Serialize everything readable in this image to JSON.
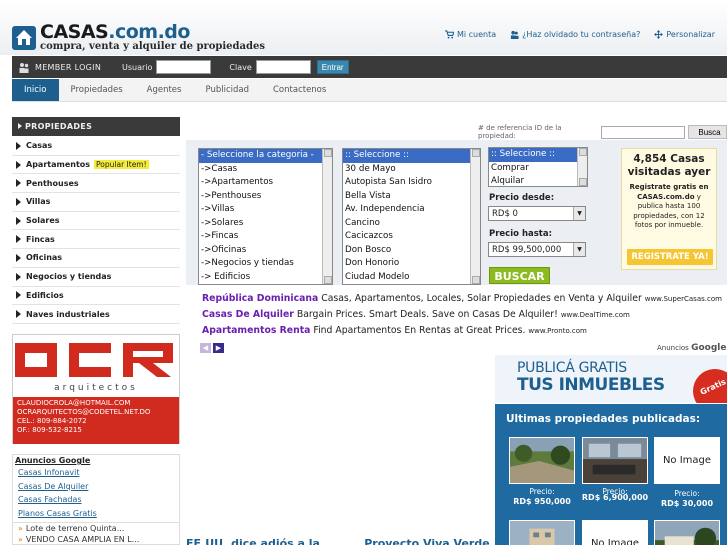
{
  "header": {
    "logo_text": "CASAS",
    "logo_domain": ".com.do",
    "tagline": "compra, venta y alquiler de propiedades",
    "links": [
      {
        "icon": "cart-icon",
        "label": "Mi cuenta"
      },
      {
        "icon": "users-icon",
        "label": "¿Haz olvidado tu contraseña?"
      },
      {
        "icon": "move-icon",
        "label": "Personalizar"
      }
    ]
  },
  "login": {
    "title": "MEMBER LOGIN",
    "user_label": "Usuario",
    "pass_label": "Clave",
    "button": "Entrar"
  },
  "nav": {
    "tabs": [
      "Inicio",
      "Propiedades",
      "Agentes",
      "Publicidad",
      "Contactenos"
    ],
    "active": "Inicio"
  },
  "sidebar": {
    "title": "PROPIEDADES",
    "items": [
      {
        "label": "Casas"
      },
      {
        "label": "Apartamentos",
        "badge": "Popular Item!"
      },
      {
        "label": "Penthouses"
      },
      {
        "label": "Villas"
      },
      {
        "label": "Solares"
      },
      {
        "label": "Fincas"
      },
      {
        "label": "Oficinas"
      },
      {
        "label": "Negocios y tiendas"
      },
      {
        "label": "Edificios"
      },
      {
        "label": "Naves industriales"
      }
    ]
  },
  "ocr_ad": {
    "logo": "OCR",
    "subtitle": "arquitectos",
    "lines": [
      "CLAUDIOCROLA@HOTMAIL.COM",
      "OCRARQUITECTOS@CODETEL.NET.DO",
      "CEL.: 809-884-2072",
      "OF.: 809-532-8215"
    ]
  },
  "google_box": {
    "title": "Anuncios Google",
    "links": [
      "Casas Infonavit",
      "Casas De Alquiler",
      "Casas Fachadas",
      "Planos Casas Gratis"
    ],
    "recent": [
      "Lote de terreno Quinta...",
      "VENDO CASA AMPLIA EN L..."
    ]
  },
  "search": {
    "ref_label": "# de referencia ID de la propiedad:",
    "ref_button": "Busca",
    "category_options": [
      "- Seleccione la categoria -",
      "->Casas",
      "->Apartamentos",
      "->Penthouses",
      "->Villas",
      "->Solares",
      "->Fincas",
      "->Oficinas",
      "->Negocios y tiendas",
      "-> Edificios"
    ],
    "sector_options": [
      ":: Seleccione ::",
      "30 de Mayo",
      "Autopista San Isidro",
      "Bella Vista",
      "Av. Independencia",
      "Cancino",
      "Cacicazcos",
      "Don Bosco",
      "Don Honorio",
      "Ciudad Modelo"
    ],
    "type_options": [
      ":: Seleccione ::",
      "Comprar",
      "Alquilar"
    ],
    "precio_desde_label": "Precio desde:",
    "precio_desde": "RD$ 0",
    "precio_hasta_label": "Precio hasta:",
    "precio_hasta": "RD$ 99,500,000",
    "button": "BUSCAR"
  },
  "promo": {
    "visits": "4,854 Casas visitadas ayer",
    "text_bold_1": "Registrate gratis en",
    "text_bold_2": "CASAS.com.do",
    "text_rest": "y publica hasta 100 propiedades, con 12 fotos por inmueble.",
    "button": "REGISTRATE YA!"
  },
  "ads": [
    {
      "title": "República Dominicana",
      "text": " Casas, Apartamentos, Locales, Solar Propiedades en Venta y Alquiler ",
      "url": "www.SuperCasas.com"
    },
    {
      "title": "Casas De Alquiler",
      "text": " Bargain Prices. Smart Deals. Save on Casas De Alquiler! ",
      "url": "www.DealTime.com"
    },
    {
      "title": "Apartamentos Renta",
      "text": " Find Apartamentos En Rentas at Great Prices. ",
      "url": "www.Pronto.com"
    }
  ],
  "ads_by": "Anuncios",
  "ads_brand": "Google",
  "publica": {
    "line1": "PUBLICÁ GRATIS",
    "line2": "TUS INMUEBLES",
    "badge": "Gratis"
  },
  "ultimas": {
    "title": "Ultimas propiedades publicadas:",
    "items": [
      {
        "image": "photo",
        "price_label": "Precio:",
        "price": "RD$ 950,000"
      },
      {
        "image": "photo",
        "price_label": "Precio:",
        "price": "RD$ 6,900,000"
      },
      {
        "image": "none",
        "no_image": "No Image",
        "price_label": "Precio:",
        "price": "RD$ 30,000"
      }
    ],
    "row2_no_image": "No Image"
  },
  "bottom_heads": [
    "EE.UU. dice adiós a la ...",
    "Proyecto Viva Verde ..."
  ],
  "colors": {
    "brand_blue": "#1d5f8f",
    "dark_bar": "#3a3a3a",
    "buscar_green": "#8bbb1e",
    "ad_title_purple": "#6a1fb0",
    "ocr_red": "#d12a1f"
  }
}
